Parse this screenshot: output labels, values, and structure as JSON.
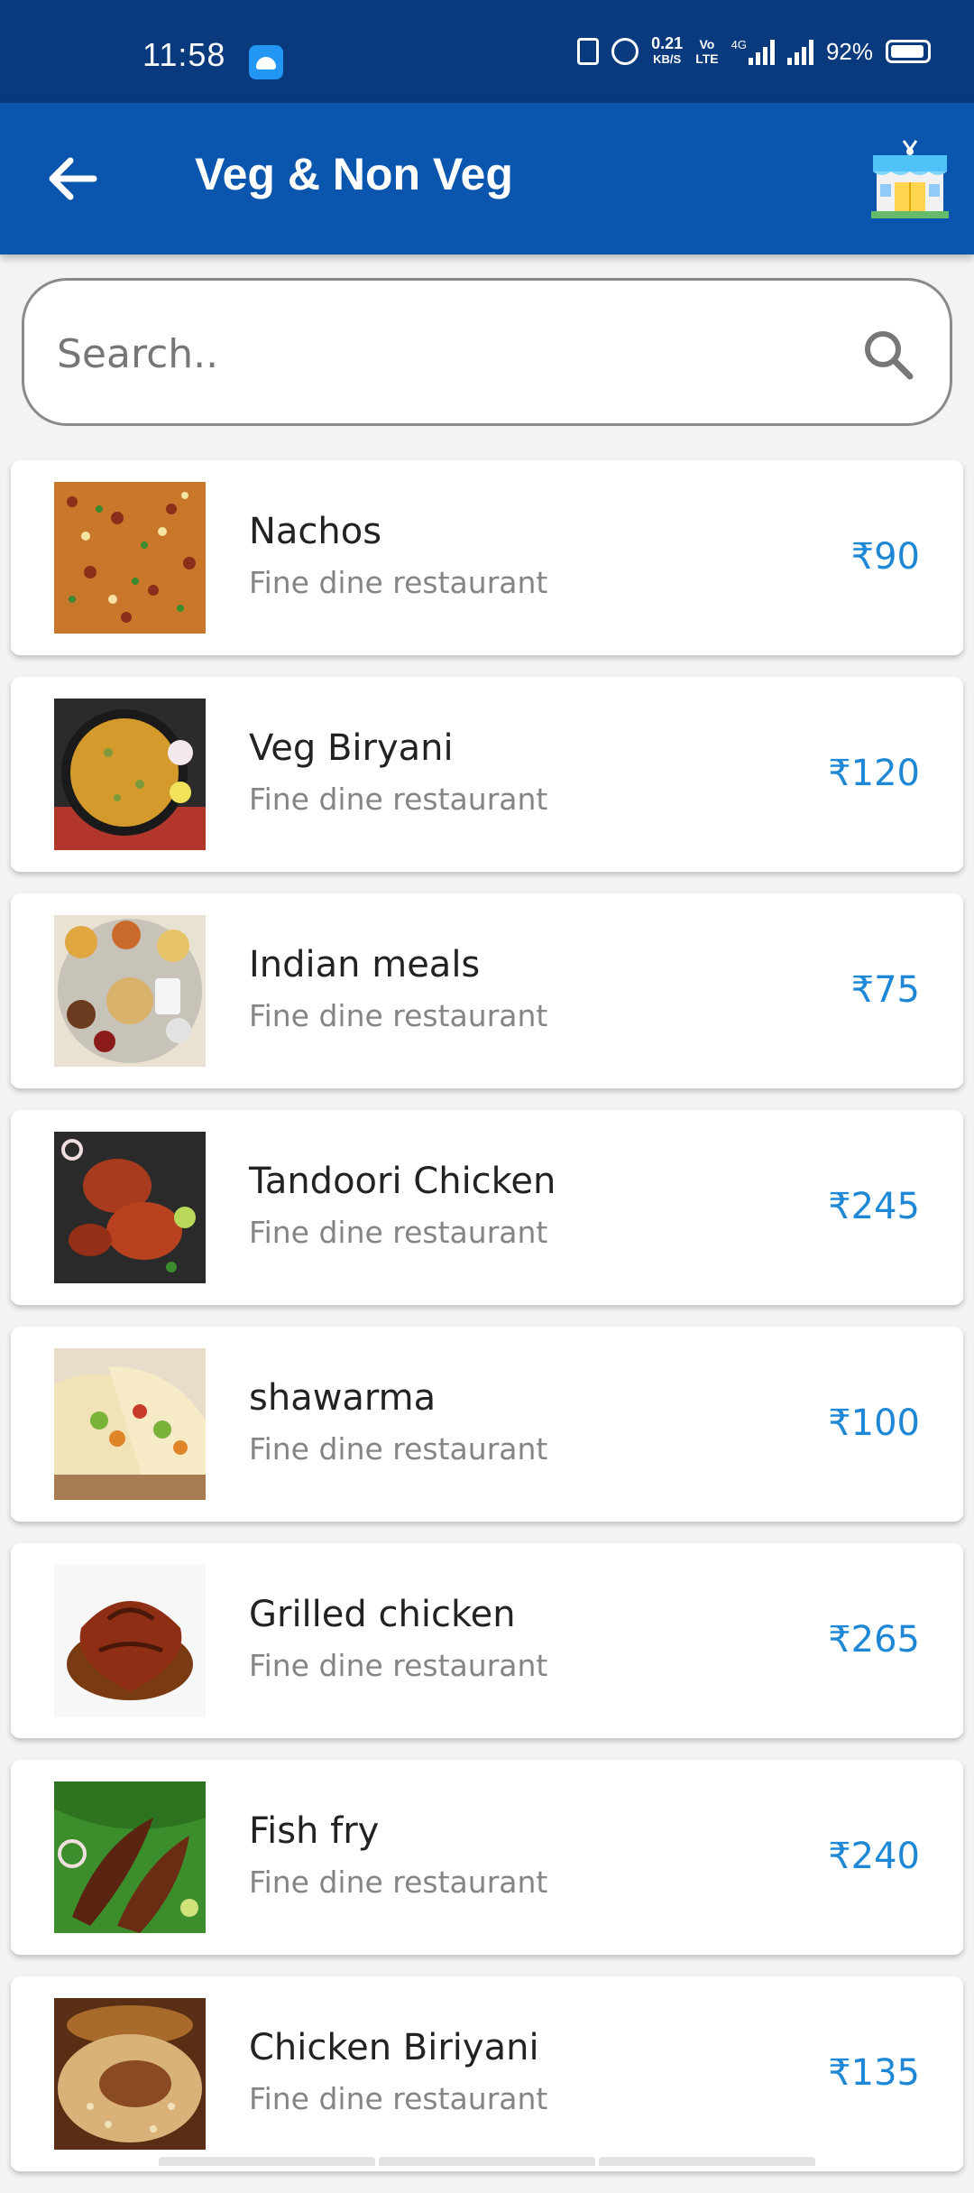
{
  "status_bar": {
    "time": "11:58",
    "network_speed_value": "0.21",
    "network_speed_unit": "KB/S",
    "volte_top": "Vo",
    "volte_bottom": "LTE",
    "network_type": "4G",
    "battery": "92%",
    "icons": [
      "android-notification-icon",
      "vibrate-icon",
      "alarm-icon",
      "signal-icon",
      "battery-icon"
    ]
  },
  "app_bar": {
    "title": "Veg & Non Veg",
    "back_icon": "arrow-back-icon",
    "store_icon": "restaurant-store-icon",
    "color": "#0a55ad"
  },
  "search": {
    "placeholder": "Search..",
    "value": "",
    "icon": "search-icon"
  },
  "items": [
    {
      "name": "Nachos",
      "restaurant": "Fine dine restaurant",
      "price": "₹90",
      "image": "nachos-image"
    },
    {
      "name": "Veg Biryani",
      "restaurant": "Fine dine restaurant",
      "price": "₹120",
      "image": "veg-biryani-image"
    },
    {
      "name": "Indian meals",
      "restaurant": "Fine dine restaurant",
      "price": "₹75",
      "image": "indian-meals-image"
    },
    {
      "name": "Tandoori Chicken",
      "restaurant": "Fine dine restaurant",
      "price": "₹245",
      "image": "tandoori-chicken-image"
    },
    {
      "name": "shawarma",
      "restaurant": "Fine dine restaurant",
      "price": "₹100",
      "image": "shawarma-image"
    },
    {
      "name": "Grilled chicken",
      "restaurant": "Fine dine restaurant",
      "price": "₹265",
      "image": "grilled-chicken-image"
    },
    {
      "name": "Fish fry",
      "restaurant": "Fine dine restaurant",
      "price": "₹240",
      "image": "fish-fry-image"
    },
    {
      "name": "Chicken Biriyani",
      "restaurant": "Fine dine restaurant",
      "price": "₹135",
      "image": "chicken-biriyani-image"
    }
  ],
  "colors": {
    "status_bar": "#0a3a7e",
    "app_bar": "#0a55ad",
    "price": "#1e88d6"
  }
}
